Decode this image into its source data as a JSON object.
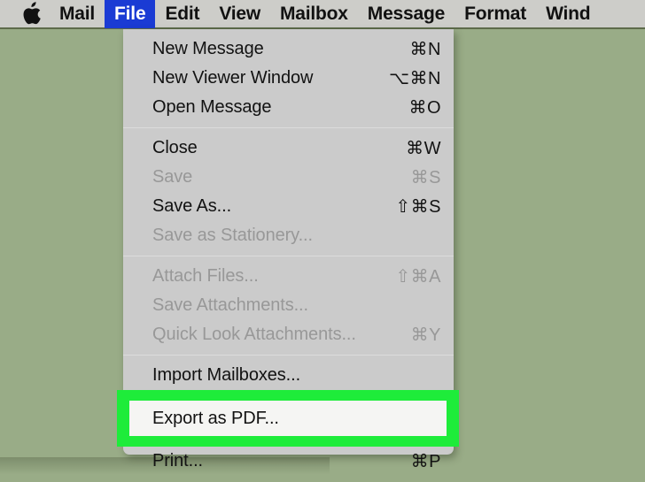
{
  "desktop": {
    "background_color": "#99ac87"
  },
  "menubar": {
    "background_color": "#cdcdc9",
    "selected_color": "#1a3bd4",
    "apple_icon": "apple-logo-icon",
    "items": [
      {
        "label": "Mail",
        "selected": false
      },
      {
        "label": "File",
        "selected": true
      },
      {
        "label": "Edit",
        "selected": false
      },
      {
        "label": "View",
        "selected": false
      },
      {
        "label": "Mailbox",
        "selected": false
      },
      {
        "label": "Message",
        "selected": false
      },
      {
        "label": "Format",
        "selected": false
      },
      {
        "label": "Wind",
        "selected": false
      }
    ]
  },
  "file_menu": {
    "background_color": "#cbcbcb",
    "groups": [
      {
        "items": [
          {
            "label": "New Message",
            "shortcut": "⌘N",
            "disabled": false
          },
          {
            "label": "New Viewer Window",
            "shortcut": "⌥⌘N",
            "disabled": false
          },
          {
            "label": "Open Message",
            "shortcut": "⌘O",
            "disabled": false
          }
        ]
      },
      {
        "items": [
          {
            "label": "Close",
            "shortcut": "⌘W",
            "disabled": false
          },
          {
            "label": "Save",
            "shortcut": "⌘S",
            "disabled": true
          },
          {
            "label": "Save As...",
            "shortcut": "⇧⌘S",
            "disabled": false
          },
          {
            "label": "Save as Stationery...",
            "shortcut": "",
            "disabled": true
          }
        ]
      },
      {
        "items": [
          {
            "label": "Attach Files...",
            "shortcut": "⇧⌘A",
            "disabled": true
          },
          {
            "label": "Save Attachments...",
            "shortcut": "",
            "disabled": true
          },
          {
            "label": "Quick Look Attachments...",
            "shortcut": "⌘Y",
            "disabled": true
          }
        ]
      },
      {
        "items": [
          {
            "label": "Import Mailboxes...",
            "shortcut": "",
            "disabled": false
          }
        ]
      }
    ],
    "highlighted_item": {
      "label": "Export as PDF...",
      "shortcut": "",
      "highlight_color": "#1eec3a",
      "row_color": "#f5f5f3"
    },
    "final_items": [
      {
        "label": "Print...",
        "shortcut": "⌘P",
        "disabled": false
      }
    ]
  }
}
